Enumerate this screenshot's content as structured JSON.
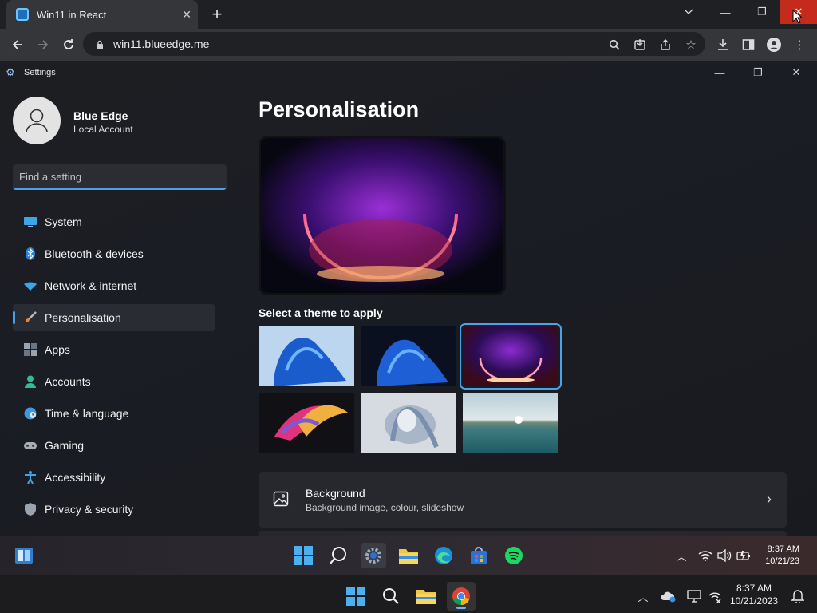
{
  "browser": {
    "tab_title": "Win11 in React",
    "url": "win11.blueedge.me"
  },
  "settings": {
    "window_title": "Settings",
    "user": {
      "name": "Blue Edge",
      "account_type": "Local Account"
    },
    "search_placeholder": "Find a setting",
    "nav": [
      {
        "label": "System",
        "icon": "monitor-icon",
        "active": false
      },
      {
        "label": "Bluetooth & devices",
        "icon": "bluetooth-icon",
        "active": false
      },
      {
        "label": "Network & internet",
        "icon": "wifi-icon",
        "active": false
      },
      {
        "label": "Personalisation",
        "icon": "paintbrush-icon",
        "active": true
      },
      {
        "label": "Apps",
        "icon": "apps-icon",
        "active": false
      },
      {
        "label": "Accounts",
        "icon": "person-icon",
        "active": false
      },
      {
        "label": "Time & language",
        "icon": "globe-clock-icon",
        "active": false
      },
      {
        "label": "Gaming",
        "icon": "gamepad-icon",
        "active": false
      },
      {
        "label": "Accessibility",
        "icon": "accessibility-icon",
        "active": false
      },
      {
        "label": "Privacy & security",
        "icon": "shield-icon",
        "active": false
      }
    ],
    "page_title": "Personalisation",
    "theme_section_label": "Select a theme to apply",
    "themes": [
      {
        "name": "light-bloom",
        "selected": false
      },
      {
        "name": "dark-bloom",
        "selected": false
      },
      {
        "name": "glow",
        "selected": true
      },
      {
        "name": "captured-motion",
        "selected": false
      },
      {
        "name": "flow",
        "selected": false
      },
      {
        "name": "sunrise",
        "selected": false
      }
    ],
    "background_card": {
      "title": "Background",
      "subtitle": "Background image, colour, slideshow"
    }
  },
  "inner_taskbar": {
    "time": "8:37 AM",
    "date": "10/21/23"
  },
  "outer_taskbar": {
    "time": "8:37 AM",
    "date": "10/21/2023"
  },
  "colors": {
    "accent": "#4aa2e8",
    "close_hover": "#c42b1c"
  }
}
